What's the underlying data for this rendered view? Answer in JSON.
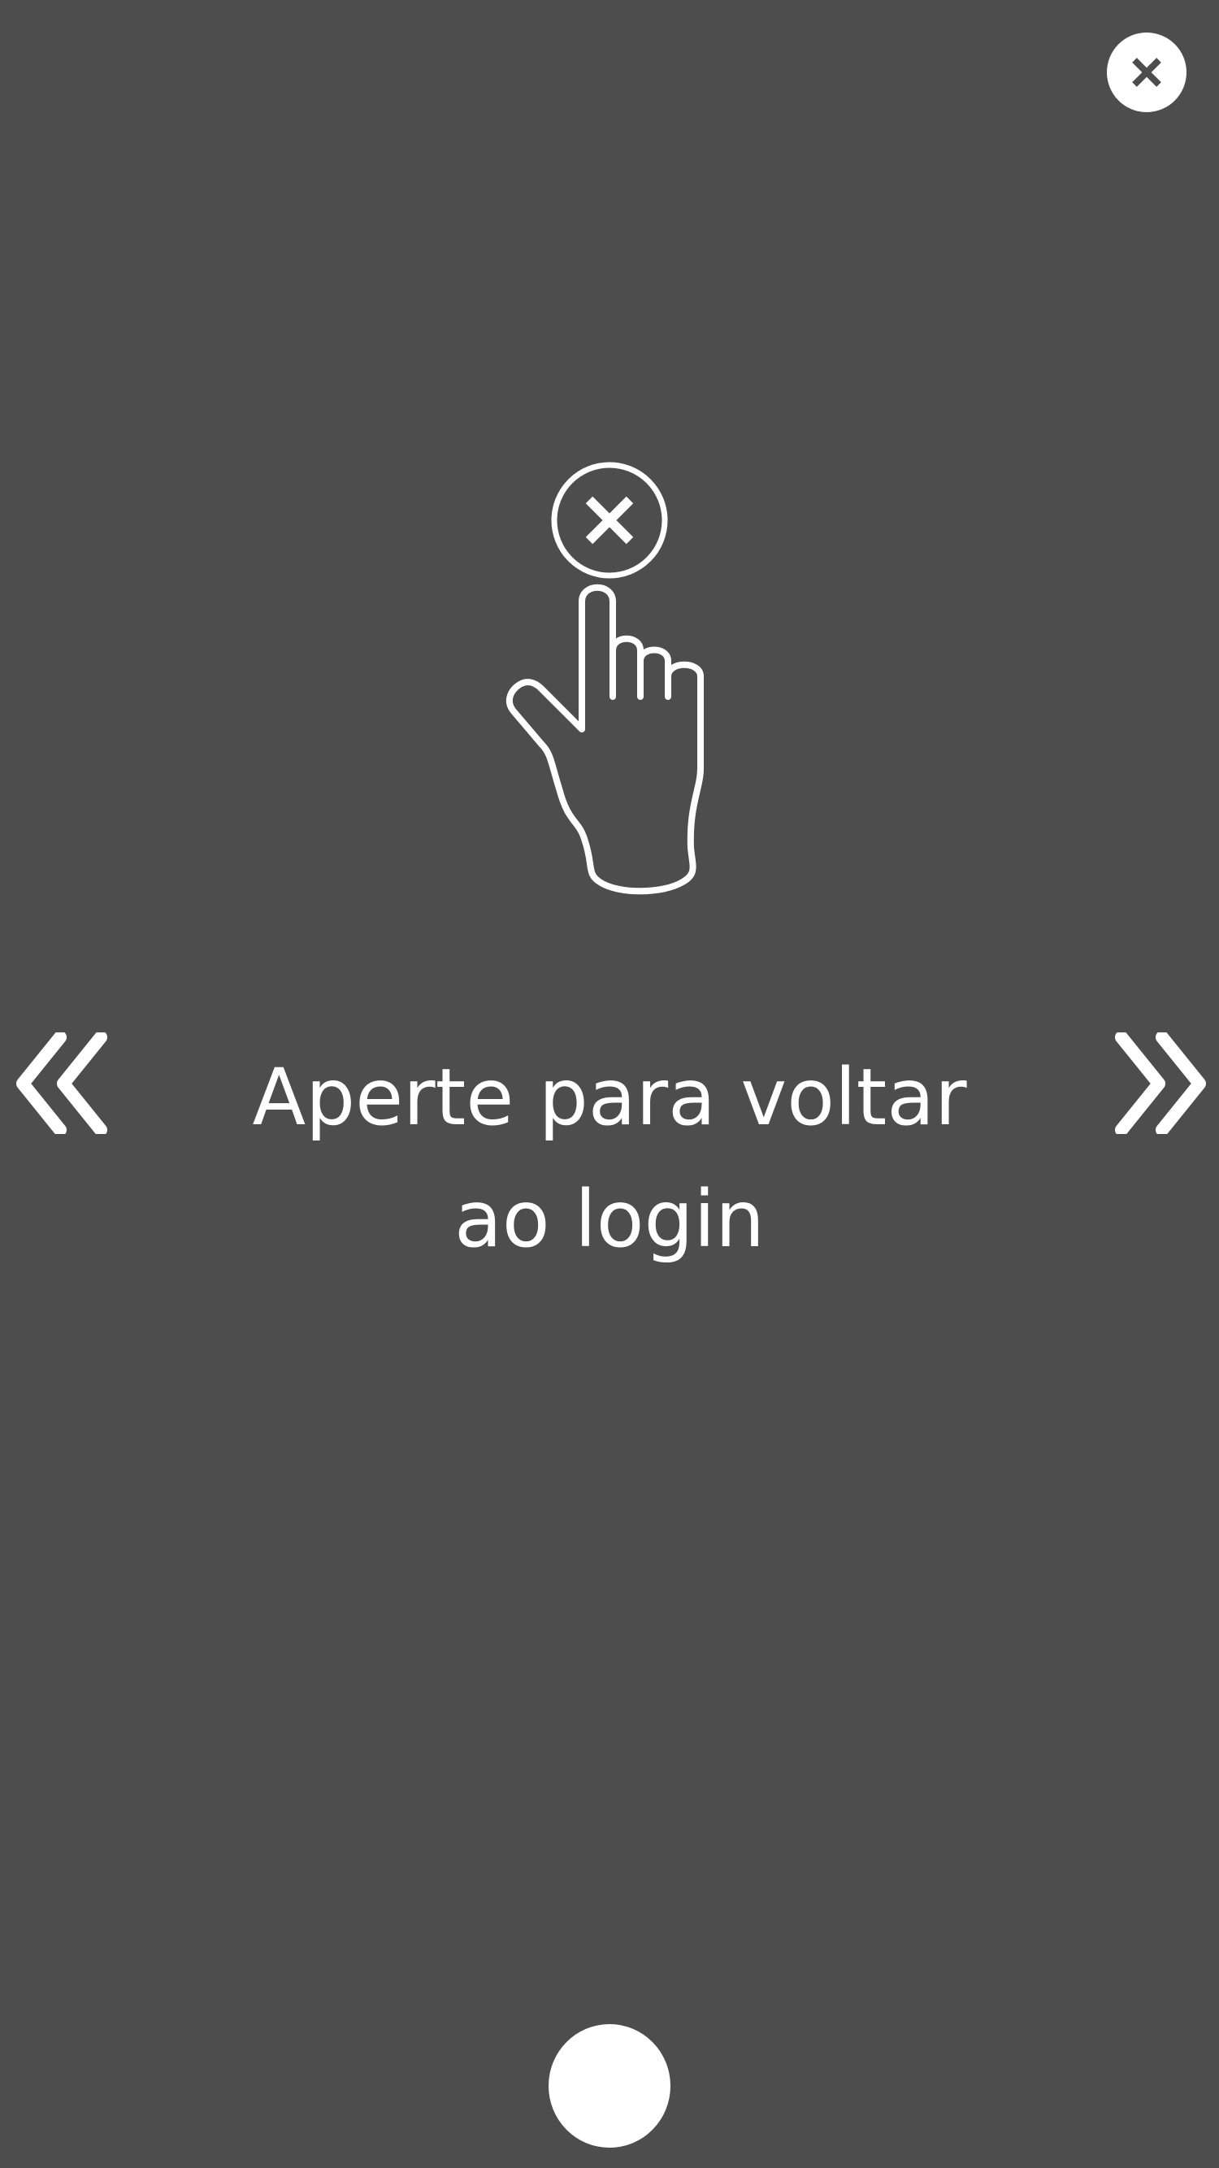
{
  "screen": {
    "background_color": "#4d4d4d",
    "foreground_color": "#ffffff"
  },
  "top_bar": {
    "close_icon": "close-icon"
  },
  "illustration": {
    "icons": [
      "close-circle-icon",
      "hand-pointer-icon"
    ]
  },
  "navigation": {
    "previous_icon": "double-chevron-left-icon",
    "next_icon": "double-chevron-right-icon"
  },
  "hint": {
    "line1": "Aperte para voltar",
    "line2": "ao login"
  },
  "bottom": {
    "home_icon": "home-button"
  }
}
